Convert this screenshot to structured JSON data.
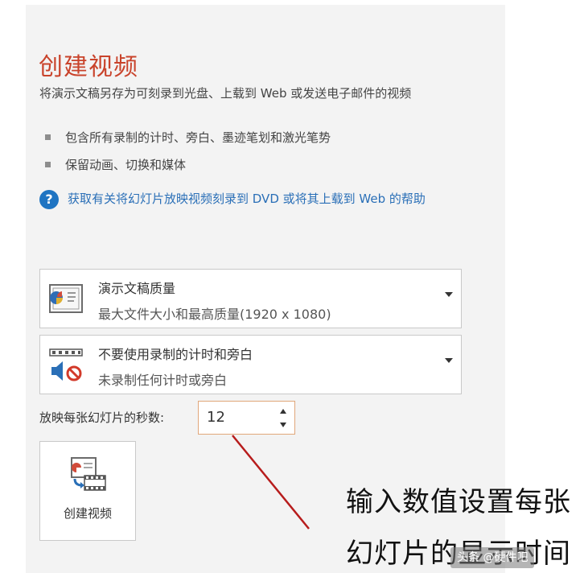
{
  "title": "创建视频",
  "description": "将演示文稿另存为可刻录到光盘、上载到 Web 或发送电子邮件的视频",
  "bullets": [
    "包含所有录制的计时、旁白、墨迹笔划和激光笔势",
    "保留动画、切换和媒体"
  ],
  "help": {
    "icon": "question-circle-icon",
    "text": "获取有关将幻灯片放映视频刻录到 DVD 或将其上载到 Web 的帮助"
  },
  "quality_dropdown": {
    "title": "演示文稿质量",
    "subtitle": "最大文件大小和最高质量(1920 x 1080)",
    "icon": "presentation-quality-icon"
  },
  "narration_dropdown": {
    "title": "不要使用录制的计时和旁白",
    "subtitle": "未录制任何计时或旁白",
    "icon": "no-narration-icon"
  },
  "seconds": {
    "label": "放映每张幻灯片的秒数:",
    "value": "12"
  },
  "create_button": {
    "label": "创建视频",
    "icon": "create-video-icon"
  },
  "annotation": {
    "line1": "输入数值设置每张",
    "line2": "幻灯片的显示时间"
  },
  "watermark": "头条 @硬件吧",
  "colors": {
    "title": "#c9432b",
    "link": "#2a6fb7",
    "annotation_line": "#b71c1c",
    "spinner_border": "#e0a77a"
  }
}
